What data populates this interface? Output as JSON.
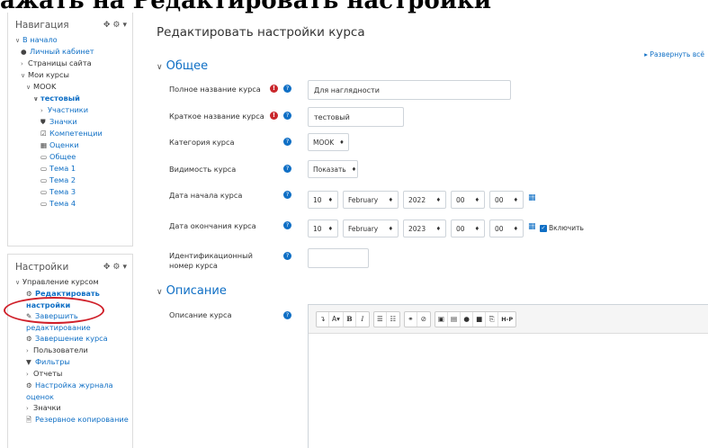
{
  "caption": "ажать на Редактировать настройки",
  "nav_block": {
    "title": "Навигация",
    "items": [
      {
        "label": "В начало"
      },
      {
        "label": "Личный кабинет"
      },
      {
        "label": "Страницы сайта"
      },
      {
        "label": "Мои курсы"
      },
      {
        "label": "MOOK"
      },
      {
        "label": "тестовый"
      },
      {
        "label": "Участники"
      },
      {
        "label": "Значки"
      },
      {
        "label": "Компетенции"
      },
      {
        "label": "Оценки"
      },
      {
        "label": "Общее"
      },
      {
        "label": "Тема 1"
      },
      {
        "label": "Тема 2"
      },
      {
        "label": "Тема 3"
      },
      {
        "label": "Тема 4"
      }
    ]
  },
  "settings_block": {
    "title": "Настройки",
    "items": [
      {
        "label": "Управление курсом"
      },
      {
        "label": "Редактировать настройки"
      },
      {
        "label": "Завершить редактирование"
      },
      {
        "label": "Завершение курса"
      },
      {
        "label": "Пользователи"
      },
      {
        "label": "Фильтры"
      },
      {
        "label": "Отчеты"
      },
      {
        "label": "Настройка журнала оценок"
      },
      {
        "label": "Значки"
      },
      {
        "label": "Резервное копирование"
      }
    ]
  },
  "main": {
    "title": "Редактировать настройки курса",
    "expand_all": "Развернуть всё",
    "section_general": "Общее",
    "section_description": "Описание",
    "fields": {
      "fullname_label": "Полное название курса",
      "fullname_value": "Для наглядности",
      "shortname_label": "Краткое название курса",
      "shortname_value": "тестовый",
      "category_label": "Категория курса",
      "category_value": "MOOK",
      "visibility_label": "Видимость курса",
      "visibility_value": "Показать",
      "startdate_label": "Дата начала курса",
      "startdate": {
        "day": "10",
        "month": "February",
        "year": "2022",
        "hour": "00",
        "minute": "00"
      },
      "enddate_label": "Дата окончания курса",
      "enddate": {
        "day": "10",
        "month": "February",
        "year": "2023",
        "hour": "00",
        "minute": "00"
      },
      "enable_label": "Включить",
      "idnumber_label": "Идентификационный номер курса",
      "idnumber_value": "",
      "description_label": "Описание курса"
    },
    "toolbar": {
      "expand": "↴",
      "font": "A",
      "bold": "B",
      "italic": "I",
      "h5p": "H-P"
    }
  },
  "colors": {
    "link": "#0f6fc5",
    "required": "#c9262b",
    "highlight": "#d0202a"
  }
}
